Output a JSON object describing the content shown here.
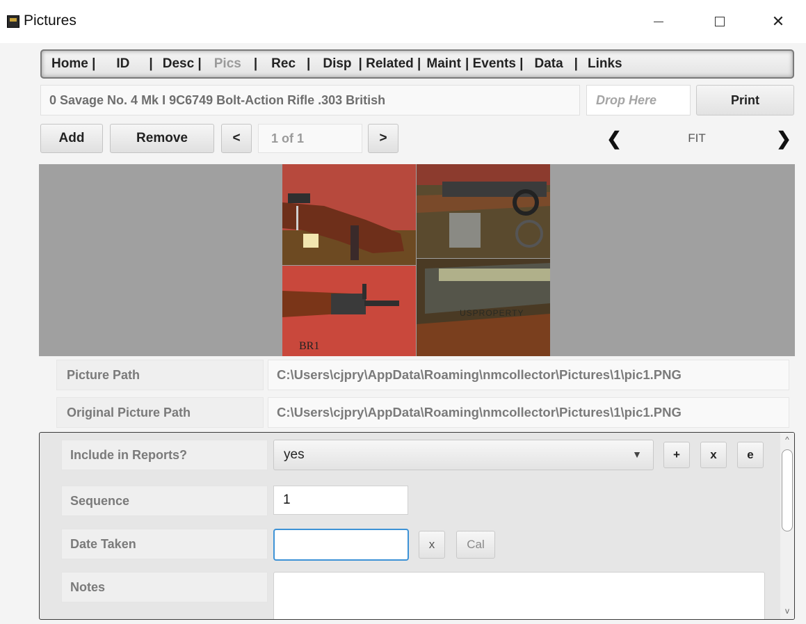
{
  "window": {
    "title": "Pictures",
    "minimize": "—",
    "close": "✕"
  },
  "nav": {
    "items": [
      {
        "label": "Home |"
      },
      {
        "label": "ID"
      },
      {
        "label": "|"
      },
      {
        "label": "Desc |"
      },
      {
        "label": "Pics"
      },
      {
        "label": "|"
      },
      {
        "label": "Rec"
      },
      {
        "label": "|"
      },
      {
        "label": "Disp"
      },
      {
        "label": "| Related |"
      },
      {
        "label": "Maint"
      },
      {
        "label": "| Events |"
      },
      {
        "label": "Data"
      },
      {
        "label": "|"
      },
      {
        "label": "Links"
      }
    ]
  },
  "record": {
    "title": "0 Savage  No. 4 Mk I 9C6749 Bolt-Action Rifle .303 British",
    "drop_placeholder": "Drop Here",
    "print_label": "Print"
  },
  "toolbar": {
    "add_label": "Add",
    "remove_label": "Remove",
    "prev_label": "<",
    "page_text": "1 of 1",
    "next_label": ">",
    "zoom_prev": "❮",
    "zoom_label": "FIT",
    "zoom_next": "❯"
  },
  "photo": {
    "caption": "BR1",
    "stamp_text": "USPROPERTY"
  },
  "paths": {
    "picture_label": "Picture Path",
    "picture_value": "C:\\Users\\cjpry\\AppData\\Roaming\\nmcollector\\Pictures\\1\\pic1.PNG",
    "original_label": "Original Picture Path",
    "original_value": "C:\\Users\\cjpry\\AppData\\Roaming\\nmcollector\\Pictures\\1\\pic1.PNG"
  },
  "details": {
    "reports_label": "Include in Reports?",
    "reports_value": "yes",
    "plus_label": "+",
    "x_label": "x",
    "e_label": "e",
    "sequence_label": "Sequence",
    "sequence_value": "1",
    "date_label": "Date Taken",
    "date_value": "",
    "date_clear_label": "x",
    "cal_label": "Cal",
    "notes_label": "Notes",
    "notes_value": ""
  },
  "scroll": {
    "up": "^",
    "down": "v"
  },
  "colors": {
    "viewer_bg": "#a0a0a0",
    "focus": "#3d92d6"
  }
}
